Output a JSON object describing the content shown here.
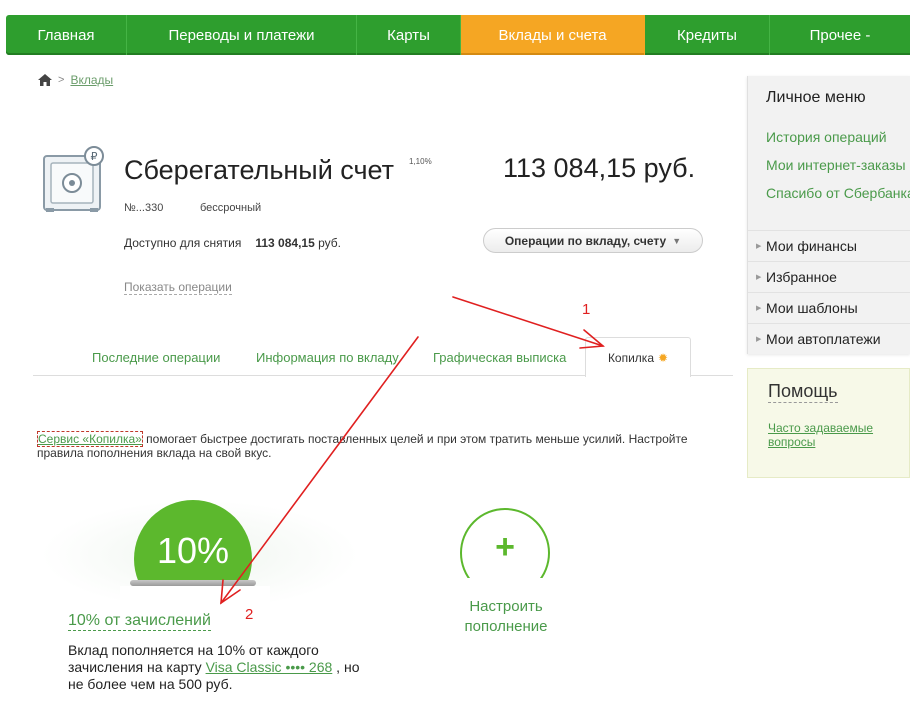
{
  "nav": {
    "items": [
      {
        "label": "Главная"
      },
      {
        "label": "Переводы и платежи"
      },
      {
        "label": "Карты"
      },
      {
        "label": "Вклады и счета"
      },
      {
        "label": "Кредиты"
      },
      {
        "label": "Прочее -"
      }
    ],
    "active_color": "#f5a623",
    "bg_color": "#2e9e2e"
  },
  "breadcrumb": {
    "icon": "home-icon",
    "link": "Вклады"
  },
  "account": {
    "title": "Сберегательный счет",
    "rate": "1,10%",
    "amount": "113 084,15 руб.",
    "number": "№...330",
    "term": "бессрочный",
    "available_label": "Доступно для снятия",
    "available_value": "113 084,15",
    "available_currency": "руб.",
    "ops_button": "Операции по вкладу, счету",
    "show_ops": "Показать операции"
  },
  "tabs": [
    {
      "label": "Последние операции"
    },
    {
      "label": "Информация по вкладу"
    },
    {
      "label": "Графическая выписка"
    },
    {
      "label": "Копилка"
    }
  ],
  "kopilka": {
    "service_link": "Сервис «Копилка»",
    "description": " помогает быстрее достигать поставленных целей и при этом тратить меньше усилий. Настройте правила пополнения вклада на свой вкус.",
    "percent": "10%",
    "percent_title": "10% от зачислений",
    "desc_part1": "Вклад пополняется на 10% от каждого зачисления на карту ",
    "card_link": "Visa Classic •••• 268",
    "desc_part2": " , но не более чем на 500 руб.",
    "add_label_1": "Настроить",
    "add_label_2": "пополнение"
  },
  "sidebar": {
    "title": "Личное меню",
    "links": [
      "История операций",
      "Мои интернет-заказы",
      "Спасибо от Сбербанка"
    ],
    "items": [
      "Мои финансы",
      "Избранное",
      "Мои шаблоны",
      "Мои автоплатежи"
    ]
  },
  "help": {
    "title": "Помощь",
    "link": "Часто задаваемые вопросы"
  },
  "annotations": {
    "one": "1",
    "two": "2",
    "color": "#e02020"
  }
}
